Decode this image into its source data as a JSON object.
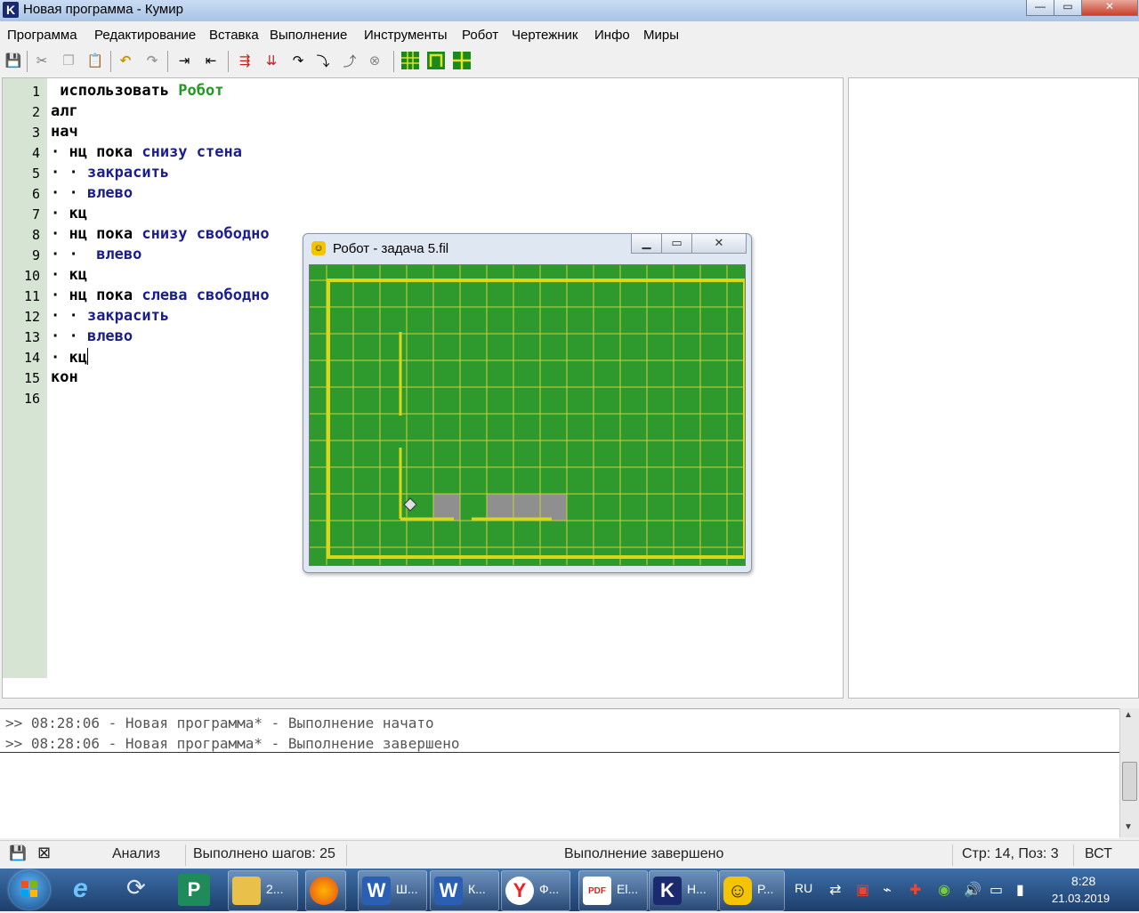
{
  "window": {
    "title": "Новая программа - Кумир",
    "app_icon_letter": "K"
  },
  "menu": [
    "Программа",
    "Редактирование",
    "Вставка",
    "Выполнение",
    "Инструменты",
    "Робот",
    "Чертежник",
    "Инфо",
    "Миры"
  ],
  "editor": {
    "line_numbers": [
      "1",
      "2",
      "3",
      "4",
      "5",
      "6",
      "7",
      "8",
      "9",
      "10",
      "11",
      "12",
      "13",
      "14",
      "15",
      "16"
    ],
    "lines": [
      [
        {
          "t": " использовать ",
          "c": "k"
        },
        {
          "t": "Робот",
          "c": "g"
        }
      ],
      [
        {
          "t": "алг",
          "c": "k"
        }
      ],
      [
        {
          "t": "нач",
          "c": "k"
        }
      ],
      [
        {
          "t": "· нц пока ",
          "c": "k"
        },
        {
          "t": "снизу стена",
          "c": "f"
        }
      ],
      [
        {
          "t": "· · ",
          "c": "k"
        },
        {
          "t": "закрасить",
          "c": "f"
        }
      ],
      [
        {
          "t": "· · ",
          "c": "k"
        },
        {
          "t": "влево",
          "c": "f"
        }
      ],
      [
        {
          "t": "· кц",
          "c": "k"
        }
      ],
      [
        {
          "t": "· нц пока ",
          "c": "k"
        },
        {
          "t": "снизу свободно",
          "c": "f"
        }
      ],
      [
        {
          "t": "· ·  ",
          "c": "k"
        },
        {
          "t": "влево",
          "c": "f"
        }
      ],
      [
        {
          "t": "· кц",
          "c": "k"
        }
      ],
      [
        {
          "t": "· нц пока ",
          "c": "k"
        },
        {
          "t": "слева свободно",
          "c": "f"
        }
      ],
      [
        {
          "t": "· · ",
          "c": "k"
        },
        {
          "t": "закрасить",
          "c": "f"
        }
      ],
      [
        {
          "t": "· · ",
          "c": "k"
        },
        {
          "t": "влево",
          "c": "f"
        }
      ],
      [
        {
          "t": "· кц",
          "c": "k"
        }
      ],
      [
        {
          "t": "кон",
          "c": "k"
        }
      ],
      []
    ],
    "colors": {
      "keyword": "#000000",
      "function": "#1a1d8c",
      "module": "#1f9a1f",
      "gutter": "#d6e4d4"
    }
  },
  "robot_window": {
    "title": "Робот - задача 5.fil",
    "field": {
      "cols": 16,
      "rows": 11,
      "colors": {
        "bg": "#2e9a2e",
        "grid": "#c8d23c",
        "wall": "#d8d81a",
        "painted": "#8f8f8f",
        "robot": "#e0e0e0"
      },
      "painted_cells": [
        [
          5,
          9
        ],
        [
          7,
          9
        ],
        [
          8,
          9
        ],
        [
          9,
          9
        ]
      ],
      "robot_cell": [
        4,
        9
      ],
      "outer_wall": true
    }
  },
  "console": {
    "messages": [
      ">> 08:28:06 - Новая программа* - Выполнение начато",
      ">> 08:28:06 - Новая программа* - Выполнение завершено"
    ]
  },
  "status": {
    "mode": "Анализ",
    "steps": "Выполнено шагов: 25",
    "state": "Выполнение завершено",
    "position": "Стр: 14, Поз: 3",
    "insert_mode": "ВСТ"
  },
  "taskbar": {
    "buttons": [
      {
        "label": "2...",
        "icon": "folder-icon",
        "color": "#e8c04a",
        "icon_text": ""
      },
      {
        "label": "",
        "icon": "firefox-icon",
        "color": "#e66a1a",
        "icon_text": ""
      },
      {
        "label": "Ш...",
        "icon": "word-icon",
        "color": "#2b5fb4",
        "icon_text": "W"
      },
      {
        "label": "К...",
        "icon": "word-icon",
        "color": "#2b5fb4",
        "icon_text": "W"
      },
      {
        "label": "Ф...",
        "icon": "yandex-icon",
        "color": "#ffffff",
        "icon_text": "Y"
      },
      {
        "label": "El...",
        "icon": "pdf-icon",
        "color": "#ffffff",
        "icon_text": "PDF"
      },
      {
        "label": "Н...",
        "icon": "kumir-icon",
        "color": "#1b2a6e",
        "icon_text": "K"
      },
      {
        "label": "Р...",
        "icon": "robot-icon",
        "color": "#f4c400",
        "icon_text": "☺"
      }
    ],
    "lang": "RU",
    "time": "8:28",
    "date": "21.03.2019"
  }
}
